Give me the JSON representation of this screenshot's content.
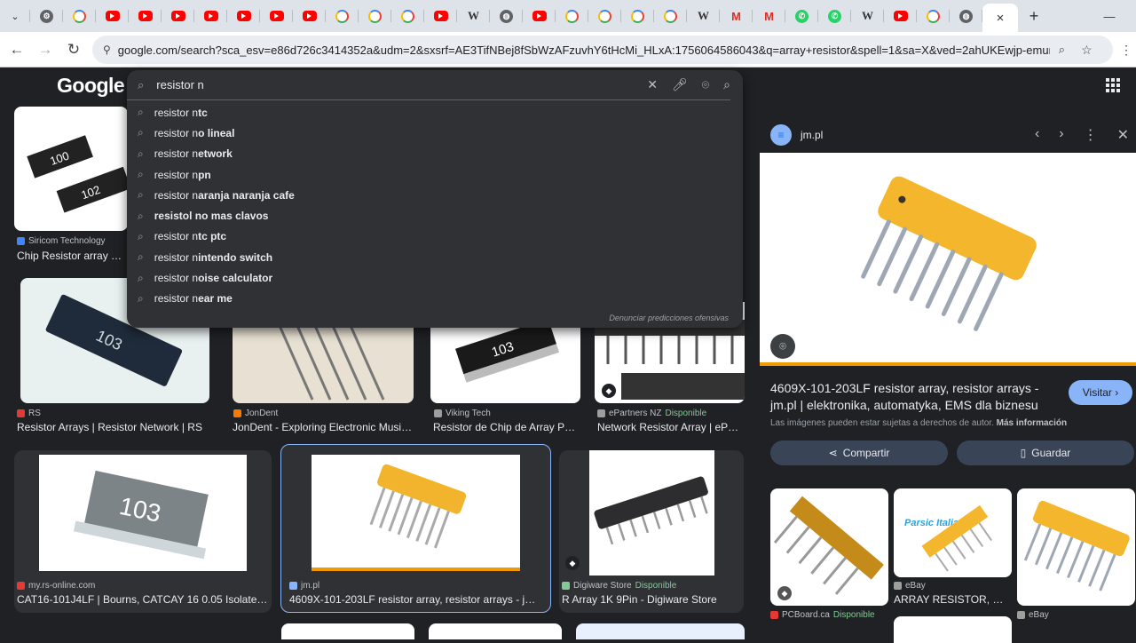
{
  "browser": {
    "tab_favicons": [
      "gear",
      "google",
      "youtube",
      "youtube",
      "youtube",
      "youtube",
      "youtube",
      "youtube",
      "youtube",
      "google",
      "google",
      "google",
      "youtube",
      "wiki",
      "globe",
      "youtube",
      "google",
      "google",
      "google",
      "google",
      "wiki",
      "gmail",
      "gmail",
      "whatsapp",
      "whatsapp",
      "wiki",
      "youtube",
      "google",
      "globe"
    ],
    "active_tab_close": "×",
    "new_tab": "+",
    "url": "google.com/search?sca_esv=e86d726c3414352a&udm=2&sxsrf=AE3TifNBej8fSbWzAFzuvhY6tHcMi_HLxA:1756064586043&q=array+resistor&spell=1&sa=X&ved=2ahUKEwjp-emumqSPAxVeqZU..."
  },
  "google": {
    "logo": "Google",
    "search_query": "resistor n",
    "suggestions": [
      {
        "prefix": "resistor n",
        "bold": "tc"
      },
      {
        "prefix": "resistor n",
        "bold": "o lineal"
      },
      {
        "prefix": "resistor n",
        "bold": "etwork"
      },
      {
        "prefix": "resistor n",
        "bold": "pn"
      },
      {
        "prefix": "resistor n",
        "bold": "aranja naranja cafe"
      },
      {
        "prefix": "",
        "bold": "resistol no mas clavos"
      },
      {
        "prefix": "resistor n",
        "bold": "tc ptc"
      },
      {
        "prefix": "resistor n",
        "bold": "intendo switch"
      },
      {
        "prefix": "resistor n",
        "bold": "oise calculator"
      },
      {
        "prefix": "resistor n",
        "bold": "ear me"
      }
    ],
    "report_link": "Denunciar predicciones ofensivas"
  },
  "results": [
    {
      "source": "Siricom Technology",
      "title": "Chip Resistor array – Sir",
      "available": ""
    },
    {
      "source": "RS",
      "title": "Resistor Arrays | Resistor Network | RS",
      "available": ""
    },
    {
      "source": "JonDent",
      "title": "JonDent - Exploring Electronic Music: ...",
      "available": ""
    },
    {
      "source": "Viking Tech",
      "title": "Resistor de Chip de Array Pla...",
      "available": ""
    },
    {
      "source": "ePartners NZ",
      "title": "Network Resistor Array | ePart...",
      "available": "Disponible"
    },
    {
      "source": "my.rs-online.com",
      "title": "CAT16-101J4LF | Bourns, CATCAY 16 0.05 Isolated Ar...",
      "available": ""
    },
    {
      "source": "jm.pl",
      "title": "4609X-101-203LF resistor array, resistor arrays - jm.pl...",
      "available": ""
    },
    {
      "source": "Digiware Store",
      "title": "R Array 1K 9Pin - Digiware Store",
      "available": "Disponible"
    }
  ],
  "chip_labels": [
    "100",
    "102",
    "103",
    "103",
    "103"
  ],
  "panel": {
    "site": "jm.pl",
    "title": "4609X-101-203LF resistor array, resistor arrays - jm.pl | elektronika, automatyka, EMS dla biznesu",
    "visit": "Visitar",
    "rights_text": "Las imágenes pueden estar sujetas a derechos de autor.",
    "more_info": "Más información",
    "share": "Compartir",
    "save": "Guardar",
    "related": [
      {
        "source": "PCBoard.ca",
        "available": "Disponible",
        "title": ""
      },
      {
        "source": "eBay",
        "available": "",
        "title": "ARRAY RESISTOR, B-..."
      },
      {
        "source": "eBay",
        "available": "",
        "title": ""
      }
    ],
    "related_watermark": "Parsic Italia"
  }
}
